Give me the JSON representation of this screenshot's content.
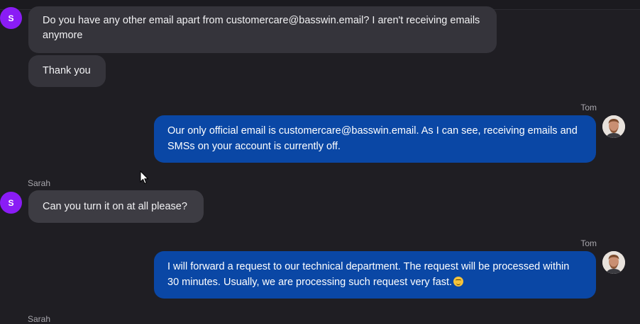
{
  "messages": [
    {
      "sender": "",
      "avatar_letter": "S",
      "text": "Do you have any other email apart from customercare@basswin.email? I aren't receiving emails anymore"
    },
    {
      "sender": "",
      "text": "Thank you"
    },
    {
      "sender": "Tom",
      "text": "Our only official email is customercare@basswin.email. As I can see, receiving emails and SMSs on your account is currently off."
    },
    {
      "sender": "Sarah",
      "avatar_letter": "S",
      "text": "Can you turn it on at all please?"
    },
    {
      "sender": "Tom",
      "text": "I will forward a request to our technical department. The request will be processed within 30 minutes. Usually, we are processing such request very fast."
    },
    {
      "sender": "Sarah",
      "text": ""
    }
  ],
  "colors": {
    "background": "#1f1e23",
    "incoming_bubble": "#35343b",
    "outgoing_bubble": "#0a47a5",
    "avatar_purple": "#8a1cf5"
  },
  "icons": {
    "emoji": "slightly-smiling-face-icon",
    "cursor": "mouse-pointer-icon"
  }
}
